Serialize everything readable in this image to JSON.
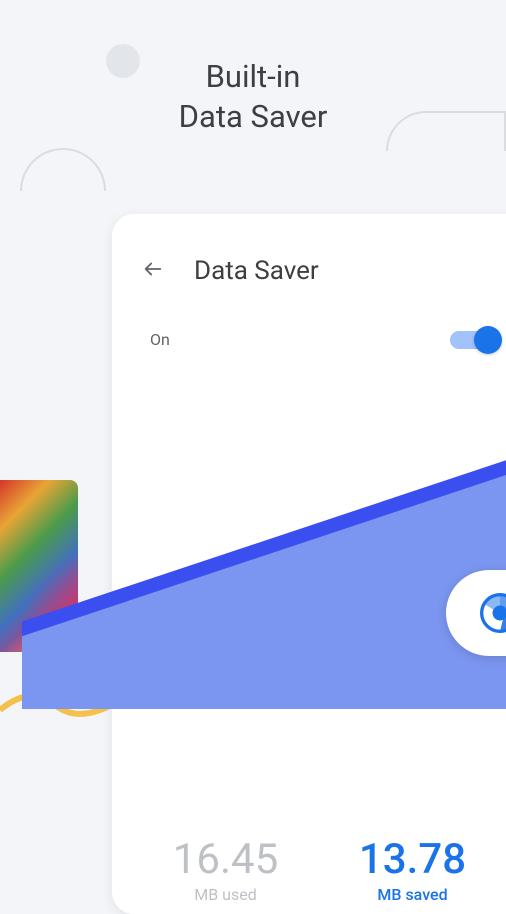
{
  "heading": {
    "line1": "Built-in",
    "line2": "Data Saver"
  },
  "card": {
    "title": "Data Saver",
    "toggle_label": "On"
  },
  "stats": {
    "used": {
      "value": "16.45",
      "label": "MB used"
    },
    "saved": {
      "value": "13.78",
      "label": "MB saved"
    }
  },
  "colors": {
    "primary": "#1a73e8",
    "chart_fill": "#7b96f0",
    "chart_line": "#3b4ef0"
  }
}
